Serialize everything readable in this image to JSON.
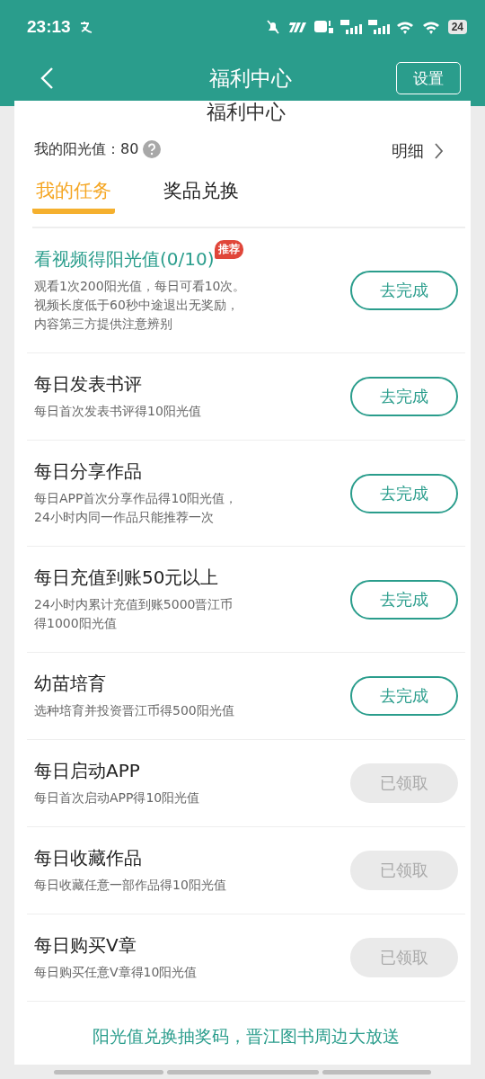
{
  "status_bar": {
    "time": "23:13",
    "battery": "24"
  },
  "header": {
    "title": "福利中心",
    "settings_button": "设置"
  },
  "card_title": "福利中心",
  "sunshine": {
    "label": "我的阳光值：80",
    "details_link": "明细"
  },
  "tabs": [
    {
      "label": "我的任务",
      "selected": true
    },
    {
      "label": "奖品兑换",
      "selected": false
    }
  ],
  "tasks": [
    {
      "title": "看视频得阳光值(0/10)",
      "highlighted": true,
      "badge": "推荐",
      "description": [
        "观看1次200阳光值，每日可看10次。",
        "视频长度低于60秒中途退出无奖励，",
        "内容第三方提供注意辨别"
      ],
      "button": "去完成",
      "claimed": false
    },
    {
      "title": "每日发表书评",
      "highlighted": false,
      "description": [
        "每日首次发表书评得10阳光值"
      ],
      "button": "去完成",
      "claimed": false
    },
    {
      "title": "每日分享作品",
      "highlighted": false,
      "description": [
        "每日APP首次分享作品得10阳光值，",
        "24小时内同一作品只能推荐一次"
      ],
      "button": "去完成",
      "claimed": false
    },
    {
      "title": "每日充值到账50元以上",
      "highlighted": false,
      "description": [
        "24小时内累计充值到账5000晋江币",
        "得1000阳光值"
      ],
      "button": "去完成",
      "claimed": false
    },
    {
      "title": "幼苗培育",
      "highlighted": false,
      "description": [
        "选种培育并投资晋江币得500阳光值"
      ],
      "button": "去完成",
      "claimed": false
    },
    {
      "title": "每日启动APP",
      "highlighted": false,
      "description": [
        "每日首次启动APP得10阳光值"
      ],
      "button": "已领取",
      "claimed": true
    },
    {
      "title": "每日收藏作品",
      "highlighted": false,
      "description": [
        "每日收藏任意一部作品得10阳光值"
      ],
      "button": "已领取",
      "claimed": true
    },
    {
      "title": "每日购买V章",
      "highlighted": false,
      "description": [
        "每日购买任意V章得10阳光值"
      ],
      "button": "已领取",
      "claimed": true
    }
  ],
  "footer": "阳光值兑换抽奖码，晋江图书周边大放送"
}
